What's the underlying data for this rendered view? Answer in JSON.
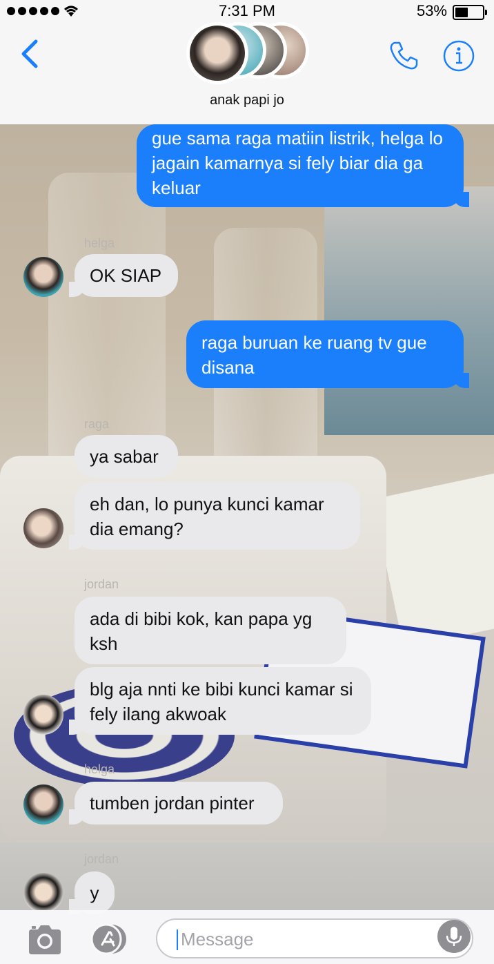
{
  "status_bar": {
    "time": "7:31 PM",
    "battery": "53%",
    "battery_level": 0.53
  },
  "header": {
    "group_name": "anak papi jo"
  },
  "messages": [
    {
      "side": "out",
      "text": "gue sama raga matiin listrik, helga lo jagain kamarnya si fely biar dia ga keluar"
    },
    {
      "side": "in",
      "sender": "helga",
      "text": "OK SIAP"
    },
    {
      "side": "out",
      "text": "raga buruan ke ruang tv gue disana"
    },
    {
      "side": "in",
      "sender": "raga",
      "text": "ya sabar"
    },
    {
      "side": "in",
      "text": "eh dan, lo punya kunci kamar dia emang?"
    },
    {
      "side": "in",
      "sender": "jordan",
      "text": "ada di bibi kok, kan papa yg ksh"
    },
    {
      "side": "in",
      "text": "blg aja nnti ke bibi kunci kamar si fely ilang akwoak"
    },
    {
      "side": "in",
      "sender": "helga",
      "text": "tumben jordan pinter"
    },
    {
      "side": "in",
      "sender": "jordan",
      "text": "y"
    }
  ],
  "composer": {
    "placeholder": "Message"
  },
  "colors": {
    "accent": "#1b7ffb",
    "incoming_bubble": "#e9e9eb"
  },
  "icons": [
    "back-chevron-icon",
    "phone-icon",
    "info-icon",
    "camera-icon",
    "app-store-icon",
    "microphone-icon"
  ]
}
